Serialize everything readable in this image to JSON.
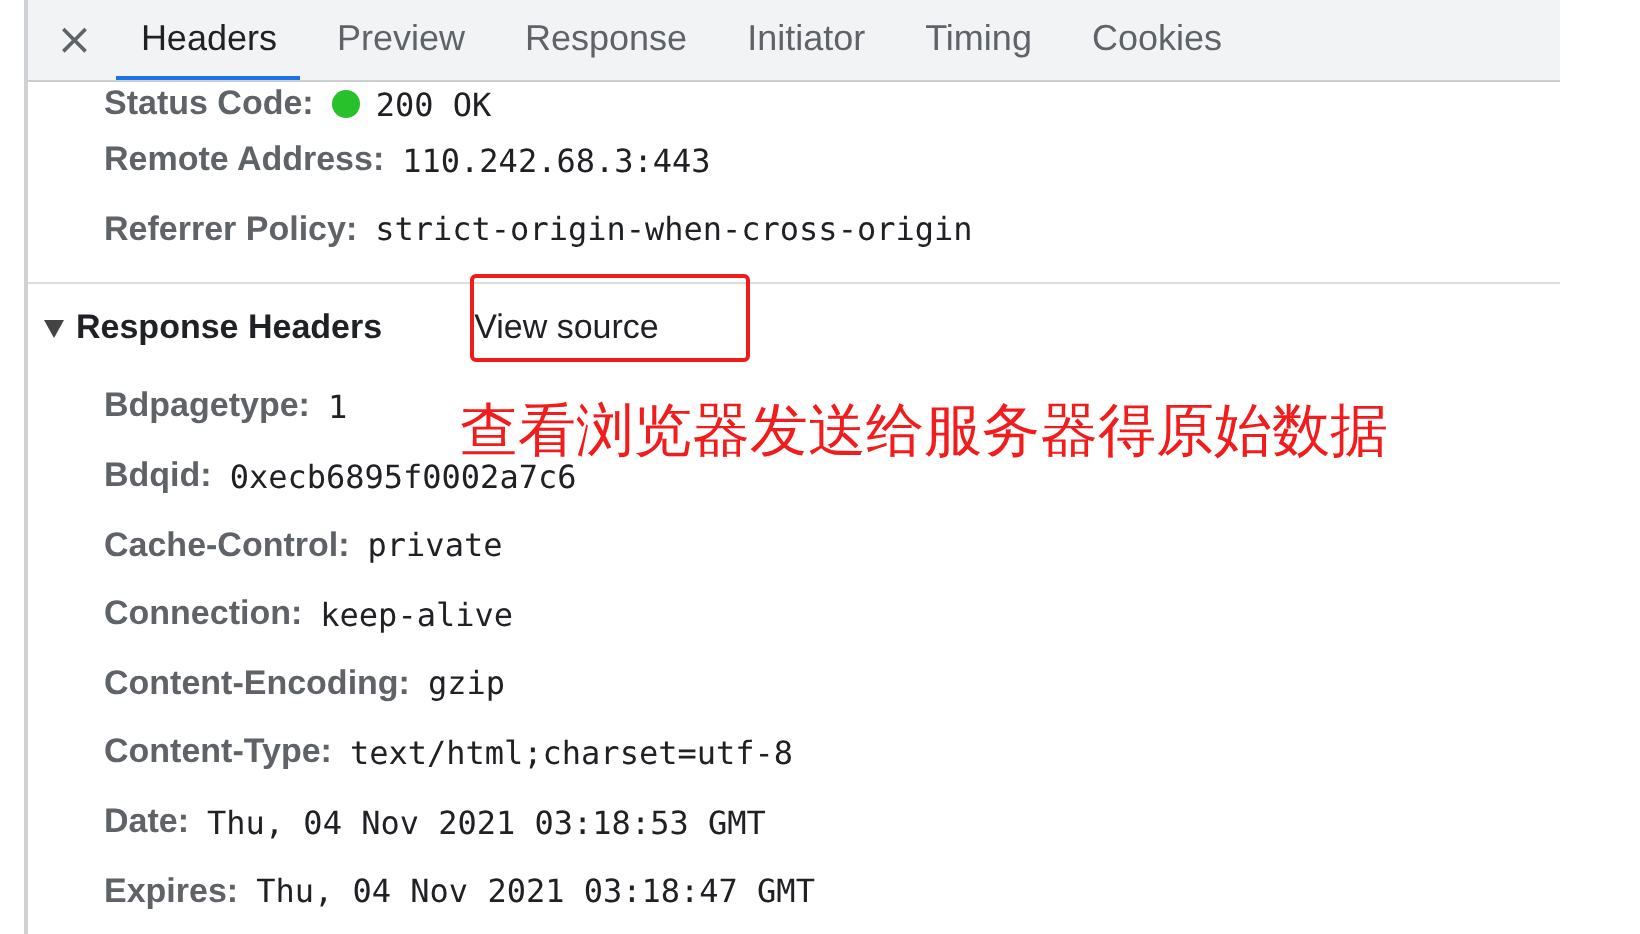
{
  "close_label": "×",
  "tabs": [
    {
      "label": "Headers",
      "selected": true
    },
    {
      "label": "Preview",
      "selected": false
    },
    {
      "label": "Response",
      "selected": false
    },
    {
      "label": "Initiator",
      "selected": false
    },
    {
      "label": "Timing",
      "selected": false
    },
    {
      "label": "Cookies",
      "selected": false
    }
  ],
  "general": [
    {
      "name": "Status Code:",
      "value": "200 OK",
      "kind": "status"
    },
    {
      "name": "Remote Address:",
      "value": "110.242.68.3:443",
      "kind": "plain"
    },
    {
      "name": "Referrer Policy:",
      "value": "strict-origin-when-cross-origin",
      "kind": "plain"
    }
  ],
  "response_headers": {
    "title": "Response Headers",
    "expanded": true,
    "view_source": "View source",
    "rows": [
      {
        "name": "Bdpagetype:",
        "value": "1"
      },
      {
        "name": "Bdqid:",
        "value": "0xecb6895f0002a7c6"
      },
      {
        "name": "Cache-Control:",
        "value": "private"
      },
      {
        "name": "Connection:",
        "value": "keep-alive"
      },
      {
        "name": "Content-Encoding:",
        "value": "gzip"
      },
      {
        "name": "Content-Type:",
        "value": "text/html;charset=utf-8"
      },
      {
        "name": "Date:",
        "value": "Thu, 04 Nov 2021 03:18:53 GMT"
      },
      {
        "name": "Expires:",
        "value": "Thu, 04 Nov 2021 03:18:47 GMT"
      }
    ]
  },
  "annotation": {
    "text": "查看浏览器发送给服务器得原始数据"
  }
}
